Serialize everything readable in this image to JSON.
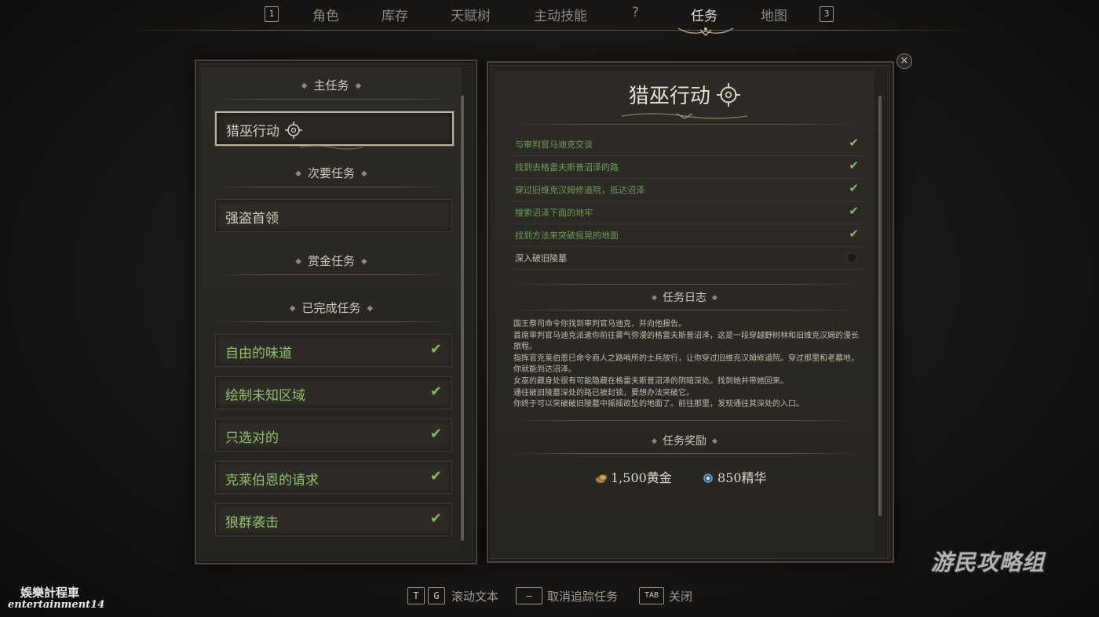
{
  "nav": {
    "left_key": "1",
    "tabs": [
      {
        "label": "角色"
      },
      {
        "label": "库存"
      },
      {
        "label": "天赋树"
      },
      {
        "label": "主动技能"
      },
      {
        "label": "?"
      },
      {
        "label": "任务",
        "active": true
      },
      {
        "label": "地图"
      }
    ],
    "right_key": "3"
  },
  "quest_list": {
    "main_header": "主任务",
    "main_quests": [
      {
        "label": "猎巫行动"
      }
    ],
    "side_header": "次要任务",
    "side_quests": [
      {
        "label": "强盗首领"
      }
    ],
    "bounty_header": "赏金任务",
    "completed_header": "已完成任务",
    "completed_quests": [
      {
        "label": "自由的味道"
      },
      {
        "label": "绘制未知区域"
      },
      {
        "label": "只选对的"
      },
      {
        "label": "克莱伯恩的请求"
      },
      {
        "label": "狼群袭击"
      }
    ]
  },
  "quest_detail": {
    "title": "猎巫行动",
    "objectives": [
      {
        "text": "与审判官马迪克交谈",
        "done": true
      },
      {
        "text": "找到去格雷夫斯普沼泽的路",
        "done": true
      },
      {
        "text": "穿过旧维克汉姆修道院，抵达沼泽",
        "done": true
      },
      {
        "text": "搜索沼泽下面的地牢",
        "done": true
      },
      {
        "text": "找到方法来突破摇晃的地面",
        "done": true
      },
      {
        "text": "深入破旧陵墓",
        "done": false
      }
    ],
    "journal_header": "任务日志",
    "journal": [
      "国王祭司命令你找到审判官马迪克，并向他报告。",
      "首席审判官马迪克派遣你前往雾气弥漫的格雷夫斯普沼泽，这是一段穿越野树林和旧维克汉姆的漫长旅程。",
      "指挥官克莱伯恩已命令商人之路哨所的士兵放行，让你穿过旧维克汉姆修道院。穿过那里和老墓地，你就能到达沼泽。",
      "女巫的藏身处很有可能隐藏在格雷夫斯普沼泽的阴暗深处。找到她并带她回来。",
      "通往破旧陵墓深处的路已被封锁，要想办法突破它。",
      "你终于可以突破破旧陵墓中摇摇欲坠的地面了。前往那里，发现通往其深处的入口。"
    ],
    "rewards_header": "任务奖励",
    "rewards": [
      {
        "amount": "1,500黄金",
        "icon": "gold-coins-icon"
      },
      {
        "amount": "850精华",
        "icon": "essence-icon"
      }
    ]
  },
  "close_label": "×",
  "hints": {
    "key_t": "T",
    "key_g": "G",
    "scroll_text": "滚动文本",
    "untrack_key": "—",
    "untrack_text": "取消追踪任务",
    "close_key": "TAB",
    "close_text": "关闭"
  },
  "watermarks": {
    "logo": "游民攻略组",
    "chinese": "娛樂計程車",
    "english": "entertainment14"
  }
}
